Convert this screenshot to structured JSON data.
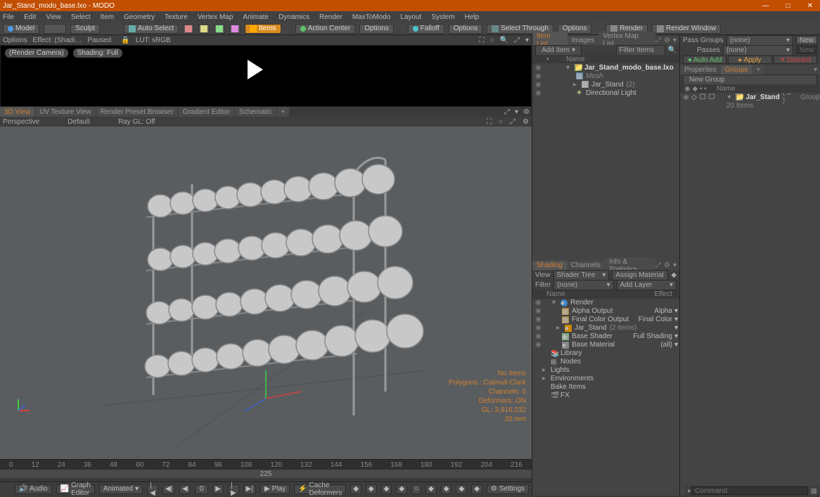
{
  "app": {
    "title": "Jar_Stand_modo_base.lxo - MODO",
    "win_min": "—",
    "win_max": "□",
    "win_close": "✕"
  },
  "menu": [
    "File",
    "Edit",
    "View",
    "Select",
    "Item",
    "Geometry",
    "Texture",
    "Vertex Map",
    "Animate",
    "Dynamics",
    "Render",
    "MaxToModo",
    "Layout",
    "System",
    "Help"
  ],
  "toolbar": {
    "model": "Model",
    "sculpt": "Sculpt",
    "autoselect": "Auto Select",
    "items": "Items",
    "action_center": "Action Center",
    "options1": "Options",
    "falloff": "Falloff",
    "options2": "Options",
    "select_through": "Select Through",
    "options3": "Options",
    "render": "Render",
    "render_window": "Render Window"
  },
  "renderbar": {
    "options": "Options",
    "effect": "Effect: (Shadi…",
    "paused": "Paused",
    "lut": "LUT: sRGB",
    "camera": "(Render Camera)",
    "shading": "Shading: Full"
  },
  "viewtabs": [
    "3D View",
    "UV Texture View",
    "Render Preset Browser",
    "Gradient Editor",
    "Schematic",
    "+"
  ],
  "vsubbar": {
    "perspective": "Perspective",
    "default": "Default",
    "raygl": "Ray GL: Off"
  },
  "stats": {
    "noitems": "No Items",
    "polygons": "Polygons : Catmull-Clark",
    "channels": "Channels: 0",
    "deformers": "Deformers: ON",
    "gl": "GL: 3,916,032",
    "unit": "20 mm"
  },
  "ruler_ticks": [
    "0",
    "12",
    "24",
    "36",
    "48",
    "60",
    "72",
    "84",
    "96",
    "108",
    "120",
    "132",
    "144",
    "156",
    "168",
    "180",
    "192",
    "204",
    "216"
  ],
  "timebar_center": "225",
  "playback": {
    "audio": "Audio",
    "graph": "Graph Editor",
    "animated": "Animated",
    "frame": "0",
    "play": "Play",
    "cache": "Cache Deformers",
    "settings": "Settings"
  },
  "itempanel": {
    "tabs": [
      "Item List",
      "Images",
      "Vertex Map List"
    ],
    "additem": "Add Item",
    "filter": "Filter Items",
    "hdr_name": "Name",
    "root": "Jar_Stand_modo_base.lxo",
    "mesh": "Mesh",
    "jarstand": "Jar_Stand",
    "jarstand_count": "(2)",
    "light": "Directional Light"
  },
  "shading": {
    "tabs": [
      "Shading",
      "Channels",
      "Info & Statistics"
    ],
    "view": "View",
    "shadertree": "Shader Tree",
    "assign": "Assign Material",
    "filter": "Filter",
    "none": "(none)",
    "addlayer": "Add Layer",
    "hdr_name": "Name",
    "hdr_effect": "Effect",
    "render": "Render",
    "alpha_out": "Alpha Output",
    "alpha": "Alpha",
    "final_color_out": "Final Color Output",
    "final_color": "Final Color",
    "jarstand": "Jar_Stand",
    "jarstand_items": "(2 items)",
    "base_shader": "Base Shader",
    "full_shading": "Full Shading",
    "base_material": "Base Material",
    "all": "(all)",
    "library": "Library",
    "nodes": "Nodes",
    "lights": "Lights",
    "environments": "Environments",
    "bake": "Bake Items",
    "fx": "FX"
  },
  "right": {
    "pass_groups": "Pass Groups",
    "none": "(none)",
    "new": "New",
    "passes": "Passes",
    "autoadd": "Auto Add",
    "apply": "Apply",
    "discard": "Discard",
    "properties": "Properties",
    "groups": "Groups",
    "newgroup": "New Group",
    "hdr_name": "Name",
    "jarstand": "Jar_Stand",
    "jarstand_count": "( 3 )",
    "group_type": "Group",
    "items_count": "20 Items"
  },
  "command": {
    "label": "Command"
  }
}
